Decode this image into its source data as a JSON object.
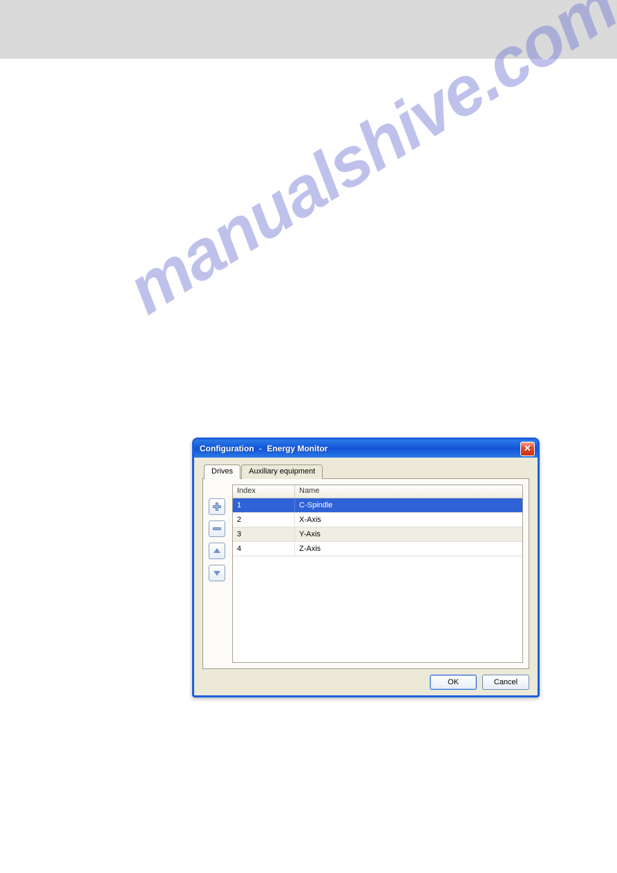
{
  "watermark": "manualshive.com",
  "dialog": {
    "title1": "Configuration",
    "sep": "-",
    "title2": "Energy Monitor",
    "tabs": [
      {
        "label": "Drives",
        "active": true
      },
      {
        "label": "Auxiliary equipment",
        "active": false
      }
    ],
    "table": {
      "columns": {
        "index": "Index",
        "name": "Name"
      },
      "rows": [
        {
          "index": "1",
          "name": "C-Spindle",
          "selected": true
        },
        {
          "index": "2",
          "name": "X-Axis",
          "selected": false
        },
        {
          "index": "3",
          "name": "Y-Axis",
          "selected": false
        },
        {
          "index": "4",
          "name": "Z-Axis",
          "selected": false
        }
      ]
    },
    "buttons": {
      "ok": "OK",
      "cancel": "Cancel"
    },
    "side_buttons": {
      "add": "add",
      "remove": "remove",
      "up": "up",
      "down": "down"
    }
  }
}
